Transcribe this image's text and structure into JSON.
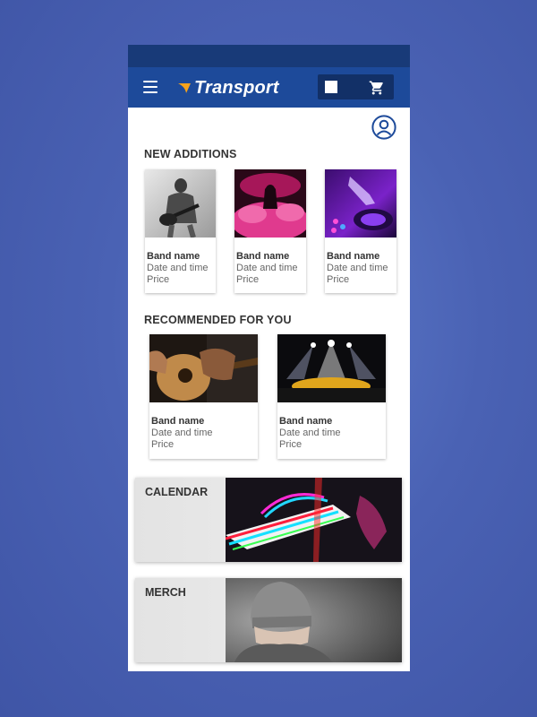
{
  "app": {
    "brand": "Transport"
  },
  "header": {
    "menu_icon": "hamburger-menu-icon",
    "square_button_icon": "white-square-icon",
    "cart_icon": "shopping-cart-icon",
    "account_icon": "user-account-icon"
  },
  "sections": {
    "new_additions": {
      "title": "NEW ADDITIONS",
      "cards": [
        {
          "band": "Band name",
          "datetime": "Date and time",
          "price": "Price",
          "image": "guitarist-photo"
        },
        {
          "band": "Band name",
          "datetime": "Date and time",
          "price": "Price",
          "image": "pink-smoke-performer-photo"
        },
        {
          "band": "Band name",
          "datetime": "Date and time",
          "price": "Price",
          "image": "dj-turntable-photo"
        }
      ]
    },
    "recommended": {
      "title": "RECOMMENDED FOR YOU",
      "cards": [
        {
          "band": "Band name",
          "datetime": "Date and time",
          "price": "Price",
          "image": "acoustic-guitar-photo"
        },
        {
          "band": "Band name",
          "datetime": "Date and time",
          "price": "Price",
          "image": "concert-stage-photo"
        }
      ]
    },
    "calendar": {
      "title": "CALENDAR",
      "image": "glitch-piano-photo"
    },
    "merch": {
      "title": "MERCH",
      "image": "beanie-person-photo"
    }
  },
  "colors": {
    "background": "#4a62b4",
    "status_bar": "#183a78",
    "app_bar": "#1d4a9a",
    "accent_orange": "#f7a21b"
  }
}
